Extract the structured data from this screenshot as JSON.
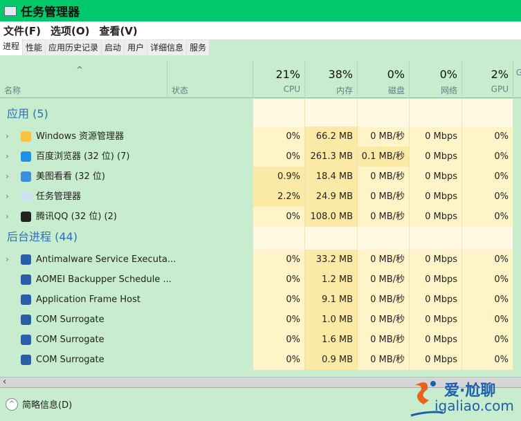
{
  "title": "任务管理器",
  "menu": [
    "文件(F)",
    "选项(O)",
    "查看(V)"
  ],
  "tabs": [
    "进程",
    "性能",
    "应用历史记录",
    "启动",
    "用户",
    "详细信息",
    "服务"
  ],
  "header": {
    "name": "名称",
    "status": "状态",
    "columns": [
      {
        "pct": "21%",
        "label": "CPU"
      },
      {
        "pct": "38%",
        "label": "内存"
      },
      {
        "pct": "0%",
        "label": "磁盘"
      },
      {
        "pct": "0%",
        "label": "网络"
      },
      {
        "pct": "2%",
        "label": "GPU"
      },
      {
        "pct": "",
        "label": "G"
      }
    ]
  },
  "groups": [
    {
      "label": "应用 (5)",
      "rows": [
        {
          "name": "Windows 资源管理器",
          "icon": "folder-icon",
          "expand": true,
          "cells": [
            "0%",
            "66.2 MB",
            "0 MB/秒",
            "0 Mbps",
            "0%"
          ],
          "hi": [
            1
          ]
        },
        {
          "name": "百度浏览器 (32 位) (7)",
          "icon": "baidu-browser-icon",
          "expand": true,
          "cells": [
            "0%",
            "261.3 MB",
            "0.1 MB/秒",
            "0 Mbps",
            "0%"
          ],
          "hi": [
            1,
            2
          ]
        },
        {
          "name": "美图看看 (32 位)",
          "icon": "meitu-icon",
          "expand": true,
          "cells": [
            "0.9%",
            "18.4 MB",
            "0 MB/秒",
            "0 Mbps",
            "0%"
          ],
          "hi": [
            0,
            1
          ]
        },
        {
          "name": "任务管理器",
          "icon": "task-manager-icon",
          "expand": true,
          "cells": [
            "2.2%",
            "24.9 MB",
            "0 MB/秒",
            "0 Mbps",
            "0%"
          ],
          "hi": [
            0,
            1
          ]
        },
        {
          "name": "腾讯QQ (32 位) (2)",
          "icon": "qq-icon",
          "expand": true,
          "cells": [
            "0%",
            "108.0 MB",
            "0 MB/秒",
            "0 Mbps",
            "0%"
          ],
          "hi": [
            1
          ]
        }
      ]
    },
    {
      "label": "后台进程 (44)",
      "rows": [
        {
          "name": "Antimalware Service Executa...",
          "icon": "service-icon",
          "expand": true,
          "cells": [
            "0%",
            "33.2 MB",
            "0 MB/秒",
            "0 Mbps",
            "0%"
          ],
          "hi": [
            1
          ]
        },
        {
          "name": "AOMEI Backupper Schedule ...",
          "icon": "service-icon",
          "expand": false,
          "cells": [
            "0%",
            "1.2 MB",
            "0 MB/秒",
            "0 Mbps",
            "0%"
          ],
          "hi": [
            1
          ]
        },
        {
          "name": "Application Frame Host",
          "icon": "service-icon",
          "expand": false,
          "cells": [
            "0%",
            "9.1 MB",
            "0 MB/秒",
            "0 Mbps",
            "0%"
          ],
          "hi": [
            1
          ]
        },
        {
          "name": "COM Surrogate",
          "icon": "service-icon",
          "expand": false,
          "cells": [
            "0%",
            "1.0 MB",
            "0 MB/秒",
            "0 Mbps",
            "0%"
          ],
          "hi": [
            1
          ]
        },
        {
          "name": "COM Surrogate",
          "icon": "service-icon",
          "expand": false,
          "cells": [
            "0%",
            "1.6 MB",
            "0 MB/秒",
            "0 Mbps",
            "0%"
          ],
          "hi": [
            1
          ]
        },
        {
          "name": "COM Surrogate",
          "icon": "service-icon",
          "expand": false,
          "cells": [
            "0%",
            "0.9 MB",
            "0 MB/秒",
            "0 Mbps",
            "0%"
          ],
          "hi": [
            1
          ]
        }
      ]
    }
  ],
  "footer": {
    "label": "简略信息(D)"
  },
  "watermark": {
    "line1": "爱·尬聊",
    "line2": "igaliao.com"
  },
  "colors": {
    "title_bar": "#00c96b",
    "body": "#c8ecce",
    "cell": "#fff4c8",
    "cell_high": "#fbe9a6",
    "group_label": "#2a6fbf"
  }
}
